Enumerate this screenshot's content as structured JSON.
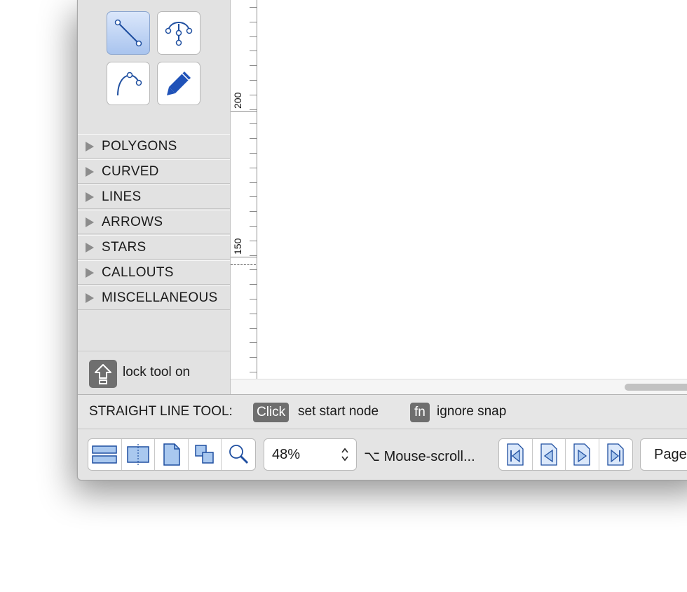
{
  "sidebar": {
    "tools": [
      {
        "icon": "straight-line-icon",
        "active": true
      },
      {
        "icon": "bezier-node-icon",
        "active": false
      },
      {
        "icon": "curve-icon",
        "active": false
      },
      {
        "icon": "pencil-icon",
        "active": false
      }
    ],
    "categories": [
      {
        "label": "POLYGONS"
      },
      {
        "label": "CURVED"
      },
      {
        "label": "LINES"
      },
      {
        "label": "ARROWS"
      },
      {
        "label": "STARS"
      },
      {
        "label": "CALLOUTS"
      },
      {
        "label": "MISCELLANEOUS"
      }
    ],
    "lock": {
      "icon": "shift-key-icon",
      "label": "lock tool on"
    }
  },
  "ruler": {
    "labels": [
      "200",
      "150"
    ]
  },
  "status": {
    "tool_name": "STRAIGHT LINE TOOL:",
    "key1": "Click",
    "action1": "set start node",
    "key2": "fn",
    "action2": "ignore snap"
  },
  "toolbar": {
    "view_buttons": [
      "single-page-view-icon",
      "two-page-view-icon",
      "page-icon",
      "overlap-pages-icon",
      "magnifier-icon"
    ],
    "zoom_value": "48%",
    "mouse_hint": "⌥ Mouse-scroll...",
    "nav_buttons": [
      "first-page-icon",
      "previous-page-icon",
      "next-page-icon",
      "last-page-icon"
    ],
    "page_label": "Page"
  },
  "colors": {
    "accent": "#1f5bb8",
    "active_tool_bg": "#a9c4ee",
    "keycap_bg": "#6e6e6e"
  }
}
